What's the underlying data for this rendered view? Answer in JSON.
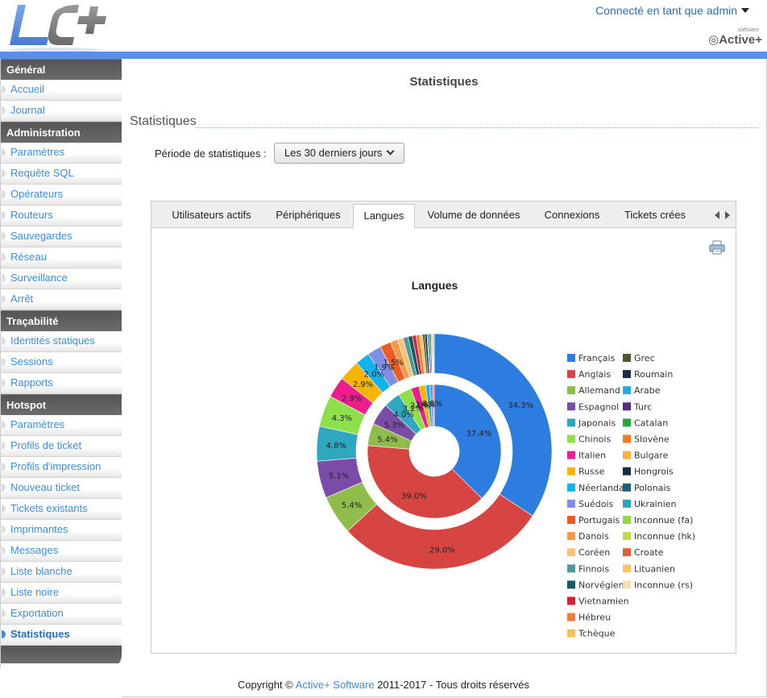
{
  "header": {
    "logo_text": "LC+",
    "user_menu": "Connecté en tant que admin",
    "brand": "Active+",
    "brand_sup": "software"
  },
  "sidebar": {
    "sections": [
      {
        "title": "Général",
        "items": [
          "Accueil",
          "Journal"
        ]
      },
      {
        "title": "Administration",
        "items": [
          "Paramètres",
          "Requête SQL",
          "Opérateurs",
          "Routeurs",
          "Sauvegardes",
          "Réseau",
          "Surveillance",
          "Arrêt"
        ]
      },
      {
        "title": "Traçabilité",
        "items": [
          "Identités statiques",
          "Sessions",
          "Rapports"
        ]
      },
      {
        "title": "Hotspot",
        "items": [
          "Paramètres",
          "Profils de ticket",
          "Profils d'impression",
          "Nouveau ticket",
          "Tickets existants",
          "Imprimantes",
          "Messages",
          "Liste blanche",
          "Liste noire",
          "Exportation",
          "Statistiques"
        ]
      }
    ],
    "active_item": "Statistiques"
  },
  "page": {
    "title": "Statistiques",
    "section_heading": "Statistiques",
    "period_label": "Période de statistiques :",
    "period_value": "Les 30 derniers jours"
  },
  "tabs": [
    "Utilisateurs actifs",
    "Périphériques",
    "Langues",
    "Volume de données",
    "Connexions",
    "Tickets crées"
  ],
  "active_tab": "Langues",
  "footer": {
    "prefix": "Copyright © ",
    "link": "Active+ Software",
    "suffix": " 2011-2017 - Tous droits réservés"
  },
  "chart_data": {
    "type": "pie",
    "title": "Langues",
    "legend_position": "right",
    "legend": [
      {
        "name": "Français",
        "color": "#2d7de0"
      },
      {
        "name": "Anglais",
        "color": "#d64541"
      },
      {
        "name": "Allemand",
        "color": "#8fbc4a"
      },
      {
        "name": "Espagnol",
        "color": "#7a4ca8"
      },
      {
        "name": "Japonais",
        "color": "#2fa7bf"
      },
      {
        "name": "Chinois",
        "color": "#8ee04a"
      },
      {
        "name": "Italien",
        "color": "#ee1d8e"
      },
      {
        "name": "Russe",
        "color": "#f7b500"
      },
      {
        "name": "Néerlandais",
        "color": "#11b3ea"
      },
      {
        "name": "Suédois",
        "color": "#7f8fe6"
      },
      {
        "name": "Portugais",
        "color": "#ef5a1e"
      },
      {
        "name": "Danois",
        "color": "#f59a4a"
      },
      {
        "name": "Coréen",
        "color": "#f8c27a"
      },
      {
        "name": "Finnois",
        "color": "#4d9a9a"
      },
      {
        "name": "Norvégien",
        "color": "#165a66"
      },
      {
        "name": "Vietnamien",
        "color": "#d42335"
      },
      {
        "name": "Hébreu",
        "color": "#f27c3a"
      },
      {
        "name": "Tchèque",
        "color": "#fbbf5a"
      },
      {
        "name": "Grec",
        "color": "#4b5a2c"
      },
      {
        "name": "Roumain",
        "color": "#1d2c44"
      },
      {
        "name": "Arabe",
        "color": "#28a9e8"
      },
      {
        "name": "Turc",
        "color": "#5b2d80"
      },
      {
        "name": "Catalan",
        "color": "#27a83e"
      },
      {
        "name": "Slovène",
        "color": "#f47b20"
      },
      {
        "name": "Bulgare",
        "color": "#fbb03b"
      },
      {
        "name": "Hongrois",
        "color": "#14323c"
      },
      {
        "name": "Polonais",
        "color": "#1b5f78"
      },
      {
        "name": "Ukrainien",
        "color": "#35a3be"
      },
      {
        "name": "Inconnue (fa)",
        "color": "#96d843"
      },
      {
        "name": "Inconnue (hk)",
        "color": "#c6d64a"
      },
      {
        "name": "Croate",
        "color": "#d9623a"
      },
      {
        "name": "Lituanien",
        "color": "#f8c46a"
      },
      {
        "name": "Inconnue (rs)",
        "color": "#f6deb4"
      }
    ],
    "outer_ring": {
      "values": [
        34.3,
        29.0,
        5.4,
        5.1,
        4.8,
        4.3,
        2.9,
        2.9,
        2.0,
        1.9,
        1.5,
        1.0,
        0.8,
        0.7,
        0.6,
        0.5,
        0.5,
        0.4,
        0.3,
        0.3,
        0.2,
        0.2,
        0.2,
        0.1,
        0.1,
        0.1,
        0.1
      ],
      "labels": [
        "34.3%",
        "29.0%",
        "5.4%",
        "5.1%",
        "4.8%",
        "4.3%",
        "2.9%",
        "2.9%",
        "2.0%",
        "1.9%",
        "1.5%",
        "",
        "",
        "",
        "",
        "",
        "",
        "",
        "",
        "",
        "",
        "",
        "",
        "",
        "",
        "",
        ""
      ]
    },
    "inner_ring": {
      "values": [
        37.4,
        39.0,
        5.4,
        5.3,
        4.0,
        3.2,
        2.0,
        1.6,
        1.0,
        0.8,
        0.3
      ],
      "labels": [
        "37.4%",
        "39.0%",
        "5.4%",
        "5.3%",
        "4.0%",
        "3.2%",
        "2.0%",
        "1.6%",
        "",
        "0.8%",
        ""
      ]
    }
  }
}
